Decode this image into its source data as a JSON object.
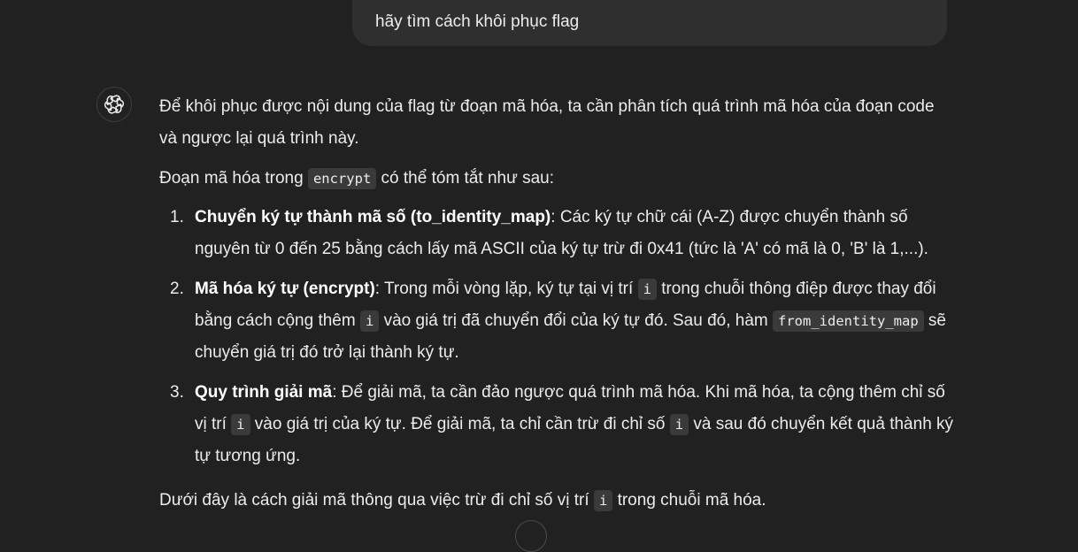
{
  "user_message": {
    "text": "hãy tìm cách khôi phục flag"
  },
  "assistant": {
    "avatar_icon": "openai-logo-icon",
    "p1": "Để khôi phục được nội dung của flag từ đoạn mã hóa, ta cần phân tích quá trình mã hóa của đoạn code và ngược lại quá trình này.",
    "p2_before": "Đoạn mã hóa trong ",
    "p2_code": "encrypt",
    "p2_after": " có thể tóm tắt như sau:",
    "items": [
      {
        "num": "1.",
        "title": "Chuyển ký tự thành mã số (to_identity_map)",
        "t1": ": Các ký tự chữ cái (A-Z) được chuyển thành số nguyên từ 0 đến 25 bằng cách lấy mã ASCII của ký tự trừ đi 0x41 (tức là 'A' có mã là 0, 'B' là 1,...)."
      },
      {
        "num": "2.",
        "title": "Mã hóa ký tự (encrypt)",
        "t1": ": Trong mỗi vòng lặp, ký tự tại vị trí ",
        "c1": "i",
        "t2": " trong chuỗi thông điệp được thay đổi bằng cách cộng thêm ",
        "c2": "i",
        "t3": " vào giá trị đã chuyển đổi của ký tự đó. Sau đó, hàm ",
        "c3": "from_identity_map",
        "t4": " sẽ chuyển giá trị đó trở lại thành ký tự."
      },
      {
        "num": "3.",
        "title": "Quy trình giải mã",
        "t1": ": Để giải mã, ta cần đảo ngược quá trình mã hóa. Khi mã hóa, ta cộng thêm chỉ số vị trí ",
        "c1": "i",
        "t2": " vào giá trị của ký tự. Để giải mã, ta chỉ cần trừ đi chỉ số ",
        "c2": "i",
        "t3": " và sau đó chuyển kết quả thành ký tự tương ứng."
      }
    ],
    "p3_before": "Dưới đây là cách giải mã thông qua việc trừ đi chỉ số vị trí ",
    "p3_code": "i",
    "p3_after": " trong chuỗi mã hóa."
  }
}
